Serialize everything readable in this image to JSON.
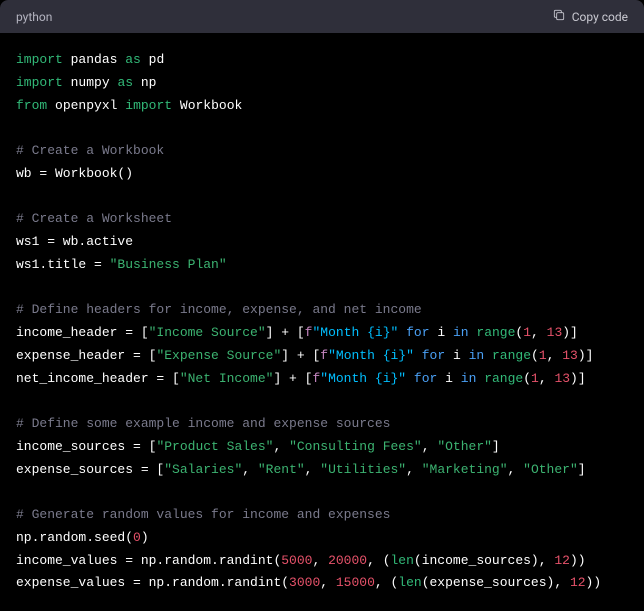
{
  "header": {
    "language": "python",
    "copy_label": "Copy code"
  },
  "code": {
    "l1_import": "import",
    "l1_pandas": "pandas",
    "l1_as": "as",
    "l1_pd": "pd",
    "l2_import": "import",
    "l2_numpy": "numpy",
    "l2_as": "as",
    "l2_np": "np",
    "l3_from": "from",
    "l3_openpyxl": "openpyxl",
    "l3_import": "import",
    "l3_workbook": "Workbook",
    "c1": "# Create a Workbook",
    "l4_wb": "wb = Workbook()",
    "c2": "# Create a Worksheet",
    "l5_ws1": "ws1 = wb.active",
    "l6_title_lhs": "ws1.title = ",
    "l6_title_str": "\"Business Plan\"",
    "c3": "# Define headers for income, expense, and net income",
    "l7_lhs": "income_header = [",
    "l7_str": "\"Income Source\"",
    "l7_mid": "] + [",
    "l7_fprefix": "f",
    "l7_fstr": "\"Month {i}\"",
    "l7_for": "for",
    "l7_i": "i",
    "l7_in": "in",
    "l7_range": "range",
    "l7_n1": "1",
    "l7_n2": "13",
    "l8_lhs": "expense_header = [",
    "l8_str": "\"Expense Source\"",
    "l8_mid": "] + [",
    "l8_fprefix": "f",
    "l8_fstr": "\"Month {i}\"",
    "l8_for": "for",
    "l8_i": "i",
    "l8_in": "in",
    "l8_range": "range",
    "l8_n1": "1",
    "l8_n2": "13",
    "l9_lhs": "net_income_header = [",
    "l9_str": "\"Net Income\"",
    "l9_mid": "] + [",
    "l9_fprefix": "f",
    "l9_fstr": "\"Month {i}\"",
    "l9_for": "for",
    "l9_i": "i",
    "l9_in": "in",
    "l9_range": "range",
    "l9_n1": "1",
    "l9_n2": "13",
    "c4": "# Define some example income and expense sources",
    "l10_lhs": "income_sources = [",
    "l10_s1": "\"Product Sales\"",
    "l10_s2": "\"Consulting Fees\"",
    "l10_s3": "\"Other\"",
    "l11_lhs": "expense_sources = [",
    "l11_s1": "\"Salaries\"",
    "l11_s2": "\"Rent\"",
    "l11_s3": "\"Utilities\"",
    "l11_s4": "\"Marketing\"",
    "l11_s5": "\"Other\"",
    "c5": "# Generate random values for income and expenses",
    "l12_lhs": "np.random.seed(",
    "l12_n": "0",
    "l12_rhs": ")",
    "l13_lhs": "income_values = np.random.randint(",
    "l13_n1": "5000",
    "l13_n2": "20000",
    "l13_len": "len",
    "l13_arg": "(income_sources)",
    "l13_n3": "12",
    "l14_lhs": "expense_values = np.random.randint(",
    "l14_n1": "3000",
    "l14_n2": "15000",
    "l14_len": "len",
    "l14_arg": "(expense_sources)",
    "l14_n3": "12"
  }
}
